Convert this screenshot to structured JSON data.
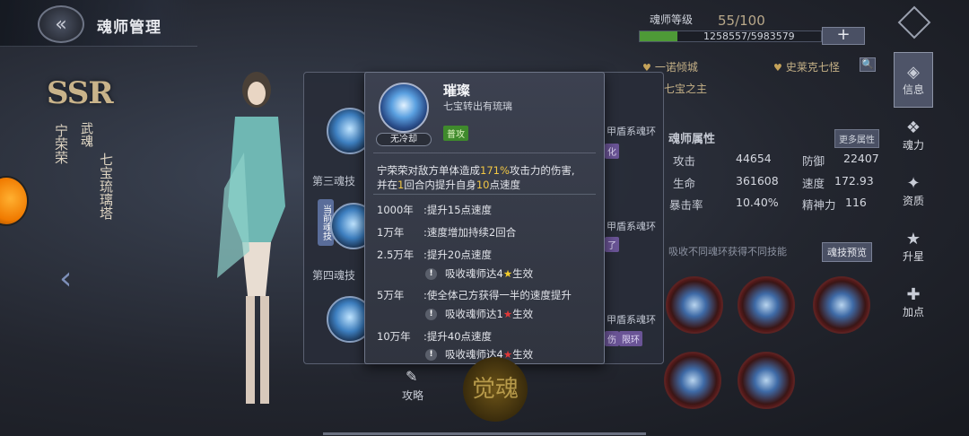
{
  "header": {
    "title": "魂师管理",
    "back_icon": "chevron-left-icon"
  },
  "character": {
    "rarity": "SSR",
    "name": "宁荣荣",
    "wuhun_label": "武魂",
    "wuhun_name": "七宝琉璃塔"
  },
  "skill_list": {
    "third_label": "第三魂技",
    "fourth_label": "第四魂技",
    "current_tag": "当前魂技",
    "ring_texts": [
      "甲盾系魂环",
      "甲盾系魂环",
      "甲盾系魂环"
    ],
    "mini_tags": [
      "化",
      "了",
      "伤",
      "限环"
    ]
  },
  "popup": {
    "skill_name": "璀璨",
    "subtitle": "七宝转出有琉璃",
    "cooldown": "无冷却",
    "type_tag": "普攻",
    "desc_line1_a": "宁荣荣对敌方单体造成",
    "desc_line1_hl": "171%",
    "desc_line1_b": "攻击力的伤害,",
    "desc_line2_a": "并在",
    "desc_line2_hl1": "1",
    "desc_line2_b": "回合内提升自身",
    "desc_line2_hl2": "10",
    "desc_line2_c": "点速度",
    "upgrades": [
      {
        "level": "1000年",
        "text": ":提升15点速度"
      },
      {
        "level": "1万年",
        "text": ":速度增加持续2回合"
      },
      {
        "level": "2.5万年",
        "text": ":提升20点速度"
      },
      {
        "level": "5万年",
        "text": ":使全体己方获得一半的速度提升"
      },
      {
        "level": "10万年",
        "text": ":提升40点速度"
      }
    ],
    "conditions": [
      {
        "text_a": "吸收魂师达4",
        "star": "★",
        "text_b": "生效"
      },
      {
        "text_a": "吸收魂师达1",
        "star": "★",
        "text_b": "生效"
      },
      {
        "text_a": "吸收魂师达4",
        "star": "★",
        "text_b": "生效"
      }
    ],
    "warn_glyph": "!"
  },
  "info": {
    "rank_label": "魂师等级",
    "rank_value": "55/100",
    "exp_text": "1258557/5983579",
    "exp_fraction": 0.21,
    "plus_label": "+",
    "guild_left": "一诺倾城",
    "guild_right": "史莱克七怪",
    "title_text": "七宝之主",
    "search_glyph": "🔍",
    "section_title": "魂师属性",
    "more_attr": "更多属性",
    "stats": [
      {
        "label": "攻击",
        "value": "44654"
      },
      {
        "label": "防御",
        "value": "22407"
      },
      {
        "label": "生命",
        "value": "361608"
      },
      {
        "label": "速度",
        "value": "172.93"
      },
      {
        "label": "暴击率",
        "value": "10.40%"
      },
      {
        "label": "精神力",
        "value": "116"
      }
    ],
    "hint": "吸收不同魂环获得不同技能",
    "preview_btn": "魂技预览"
  },
  "tabs": [
    {
      "label": "信息",
      "icon": "info-icon",
      "glyph": "◈"
    },
    {
      "label": "魂力",
      "icon": "soul-power-icon",
      "glyph": "❖"
    },
    {
      "label": "资质",
      "icon": "aptitude-icon",
      "glyph": "✦"
    },
    {
      "label": "升星",
      "icon": "star-up-icon",
      "glyph": "★"
    },
    {
      "label": "加点",
      "icon": "add-point-icon",
      "glyph": "✚"
    }
  ],
  "bottom": {
    "guide_label": "攻略",
    "awaken_label": "觉魂"
  },
  "colors": {
    "accent_gold": "#f2c744",
    "exp_green": "#4e9a37",
    "type_green": "#3f8a2c",
    "star_red": "#e23838"
  }
}
